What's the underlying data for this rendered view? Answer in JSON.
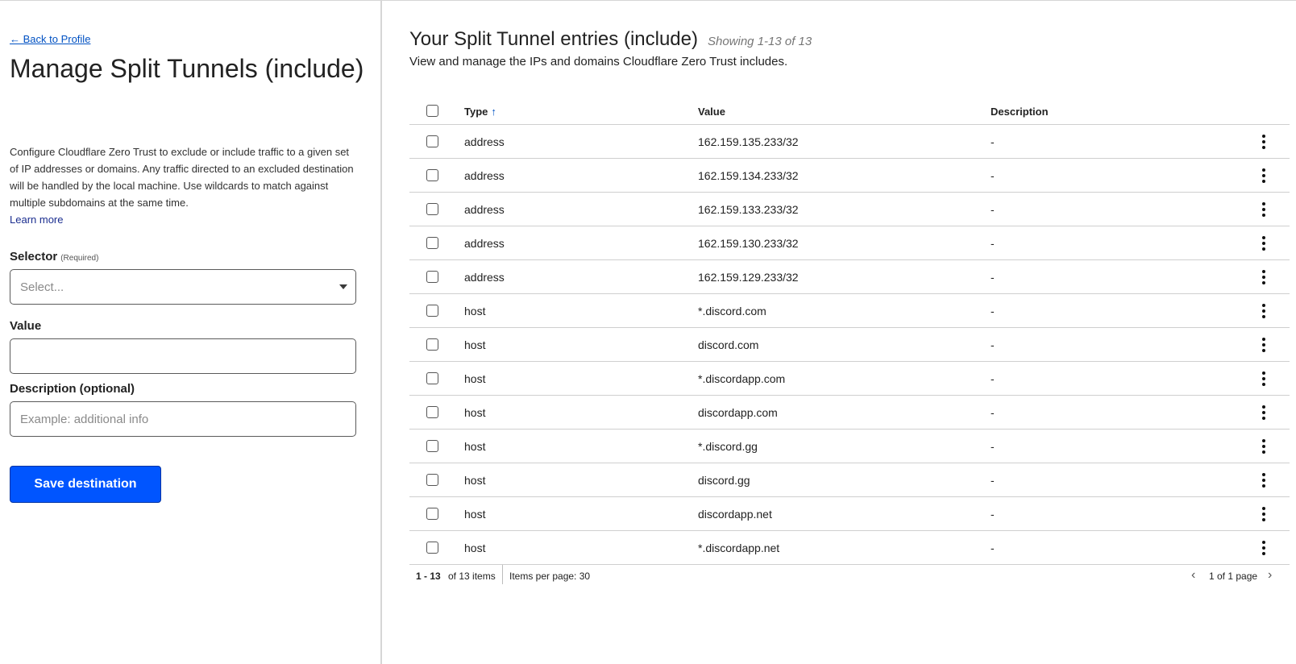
{
  "left": {
    "back_link": "← Back to Profile",
    "title": "Manage Split Tunnels (include)",
    "description": "Configure Cloudflare Zero Trust to exclude or include traffic to a given set of IP addresses or domains. Any traffic directed to an excluded destination will be handled by the local machine. Use wildcards to match against multiple subdomains at the same time.",
    "learn_more": "Learn more",
    "selector_label": "Selector",
    "selector_required": "(Required)",
    "selector_placeholder": "Select...",
    "value_label": "Value",
    "value_value": "",
    "description_label": "Description (optional)",
    "description_placeholder": "Example: additional info",
    "save_button": "Save destination"
  },
  "right": {
    "title": "Your Split Tunnel entries (include)",
    "showing": "Showing 1-13 of 13",
    "subtitle": "View and manage the IPs and domains Cloudflare Zero Trust includes."
  },
  "table": {
    "headers": {
      "type": "Type",
      "sort_icon": "↑",
      "value": "Value",
      "description": "Description"
    },
    "rows": [
      {
        "type": "address",
        "value": "162.159.135.233/32",
        "description": "-"
      },
      {
        "type": "address",
        "value": "162.159.134.233/32",
        "description": "-"
      },
      {
        "type": "address",
        "value": "162.159.133.233/32",
        "description": "-"
      },
      {
        "type": "address",
        "value": "162.159.130.233/32",
        "description": "-"
      },
      {
        "type": "address",
        "value": "162.159.129.233/32",
        "description": "-"
      },
      {
        "type": "host",
        "value": "*.discord.com",
        "description": "-"
      },
      {
        "type": "host",
        "value": "discord.com",
        "description": "-"
      },
      {
        "type": "host",
        "value": "*.discordapp.com",
        "description": "-"
      },
      {
        "type": "host",
        "value": "discordapp.com",
        "description": "-"
      },
      {
        "type": "host",
        "value": "*.discord.gg",
        "description": "-"
      },
      {
        "type": "host",
        "value": "discord.gg",
        "description": "-"
      },
      {
        "type": "host",
        "value": "discordapp.net",
        "description": "-"
      },
      {
        "type": "host",
        "value": "*.discordapp.net",
        "description": "-"
      }
    ]
  },
  "pagination": {
    "range": "1 - 13",
    "of_items": "of 13 items",
    "items_per_page": "Items per page: 30",
    "page_info": "1 of 1 page",
    "prev_icon": "‹",
    "next_icon": "›"
  },
  "colors": {
    "accent": "#0055ff",
    "link": "#0051c3",
    "border": "#cfcfcf"
  }
}
